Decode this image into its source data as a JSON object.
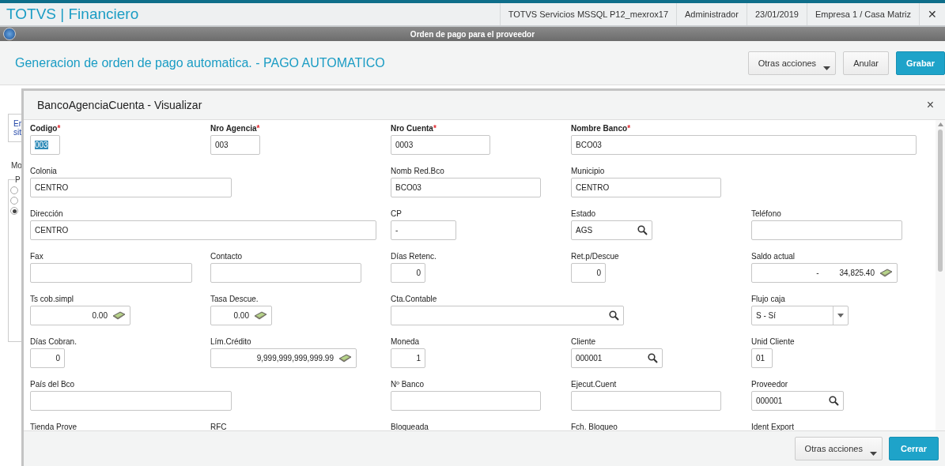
{
  "app_bar": {
    "title": "TOTVS | Financiero",
    "info": [
      "TOTVS Servicios MSSQL P12_mexrox17",
      "Administrador",
      "23/01/2019",
      "Empresa 1 / Casa Matriz"
    ],
    "close": "✕"
  },
  "window": {
    "title": "Orden de pago para el proveedor"
  },
  "form_header": {
    "title": "Generacion de orden de pago automatica. - PAGO AUTOMATICO",
    "buttons": [
      {
        "label": "Otras acciones",
        "kind": "menu"
      },
      {
        "label": "Anular",
        "kind": "plain"
      },
      {
        "label": "Grabar",
        "kind": "primary"
      }
    ]
  },
  "background": {
    "notice": [
      "Er",
      "sit"
    ],
    "label": "Mo",
    "group": "P",
    "radios": [
      {
        "selected": false
      },
      {
        "selected": false
      },
      {
        "selected": true
      }
    ]
  },
  "dialog": {
    "title": "BancoAgenciaCuenta - Visualizar",
    "close": "×",
    "rows": [
      [
        {
          "label": "Codigo",
          "required_mark": "*",
          "kind": "text",
          "value": "003",
          "value_selected": true
        },
        {
          "label": "Nro Agencia",
          "required_mark": "*",
          "kind": "text",
          "value": "003",
          "value_selected": false
        },
        {
          "label": "Nro Cuenta",
          "required_mark": "*",
          "kind": "text",
          "value": "0003",
          "value_selected": false
        },
        {
          "label": "Nombre Banco",
          "required_mark": "*",
          "kind": "text",
          "value": "BCO03",
          "value_selected": false
        },
        null
      ],
      [
        {
          "label": "Colonia",
          "kind": "text",
          "value": "CENTRO"
        },
        null,
        {
          "label": "Nomb Red.Bco",
          "kind": "text",
          "value": "BCO03"
        },
        {
          "label": "Municipio",
          "kind": "text",
          "value": "CENTRO"
        },
        null
      ],
      [
        {
          "label": "Dirección",
          "kind": "text",
          "value": "CENTRO"
        },
        null,
        {
          "label": "CP",
          "kind": "text",
          "value": "-"
        },
        {
          "label": "Estado",
          "kind": "lookup",
          "value": "AGS"
        },
        {
          "label": "Teléfono",
          "kind": "text"
        }
      ],
      [
        {
          "label": "Fax",
          "kind": "text"
        },
        {
          "label": "Contacto",
          "kind": "text"
        },
        {
          "label": "Días Retenc.",
          "kind": "number",
          "value": "0"
        },
        {
          "label": "Ret.p/Descue",
          "kind": "number",
          "value": "0"
        },
        {
          "label": "Saldo actual",
          "kind": "money",
          "sign": "-",
          "value": "34,825.40"
        }
      ],
      [
        {
          "label": "Ts cob.simpl",
          "kind": "money",
          "value": "0.00"
        },
        {
          "label": "Tasa Descue.",
          "kind": "money",
          "value": "0.00"
        },
        {
          "label": "Cta.Contable",
          "kind": "lookup"
        },
        null,
        {
          "label": "Flujo caja",
          "kind": "select",
          "value": "S - Sí"
        }
      ],
      [
        {
          "label": "Días Cobran.",
          "kind": "number",
          "value": "0"
        },
        {
          "label": "Lím.Crédito",
          "kind": "money",
          "value": "9,999,999,999,999.99"
        },
        {
          "label": "Moneda",
          "kind": "number",
          "value": "1"
        },
        {
          "label": "Cliente",
          "kind": "lookup",
          "value": "000001"
        },
        {
          "label": "Unid Cliente",
          "kind": "text",
          "value": "01"
        }
      ],
      [
        {
          "label": "País del Bco",
          "kind": "text"
        },
        null,
        {
          "label": "Nº Banco",
          "kind": "text"
        },
        {
          "label": "Ejecut.Cuent",
          "kind": "text"
        },
        {
          "label": "Proveedor",
          "kind": "lookup",
          "value": "000001"
        }
      ],
      [
        {
          "label": "Tienda Prove",
          "kind": "label"
        },
        {
          "label": "RFC",
          "kind": "label"
        },
        {
          "label": "Bloqueada",
          "kind": "label"
        },
        {
          "label": "Fch. Bloqueo",
          "kind": "label"
        },
        {
          "label": "Ident Export",
          "kind": "label"
        }
      ]
    ],
    "buttons": [
      {
        "label": "Otras acciones",
        "kind": "menu"
      },
      {
        "label": "Cerrar",
        "kind": "primary"
      }
    ]
  }
}
